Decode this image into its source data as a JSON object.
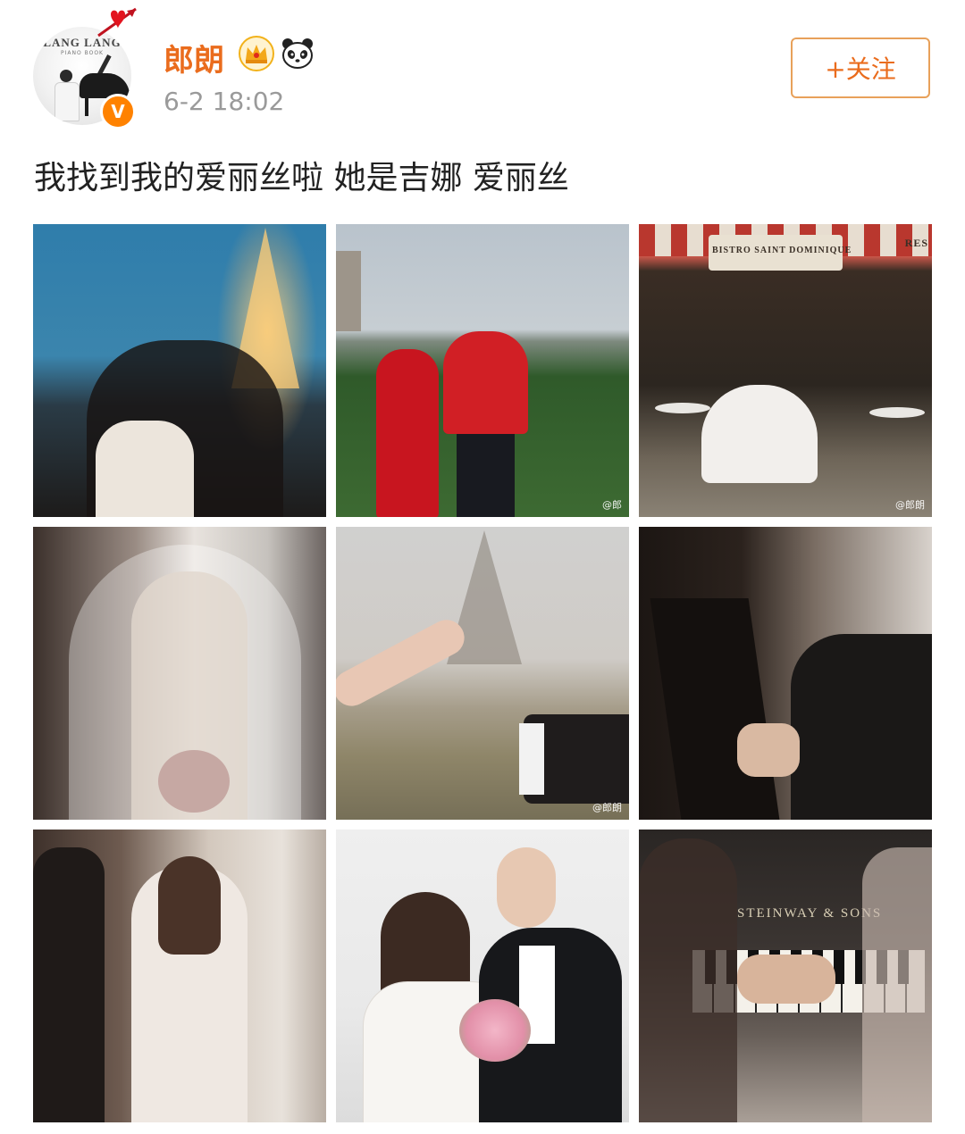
{
  "post": {
    "user": {
      "name": "郎朗",
      "avatar_logo": "LANG LANG",
      "avatar_logo_sub": "PIANO BOOK",
      "verified_mark": "V"
    },
    "time": "6-2 18:02",
    "follow_label": "+关注",
    "text": "我找到我的爱丽丝啦 她是吉娜 爱丽丝"
  },
  "photos": [
    {
      "id": "photo-1",
      "subject": "couple-eiffel-tower-night"
    },
    {
      "id": "photo-2",
      "subject": "couple-red-qipao"
    },
    {
      "id": "photo-3",
      "subject": "bistro-cafe-scene",
      "sign": "BISTRO SAINT DOMINIQUE",
      "corner_sign": "RES",
      "watermark": "@郎朗"
    },
    {
      "id": "photo-4",
      "subject": "bride-veil-window"
    },
    {
      "id": "photo-5",
      "subject": "hands-rings-eiffel-tower",
      "watermark": "@郎朗"
    },
    {
      "id": "photo-6",
      "subject": "man-playing-piano"
    },
    {
      "id": "photo-7",
      "subject": "bride-groom-window"
    },
    {
      "id": "photo-8",
      "subject": "couple-studio-portrait"
    },
    {
      "id": "photo-9",
      "subject": "hands-on-piano-keys",
      "piano_brand": "STEINWAY & SONS"
    }
  ],
  "photo2_watermark": "@郎",
  "colors": {
    "accent": "#ea6c1d",
    "verified": "#ff8200",
    "follow_border": "#e8a15a",
    "time": "#9a9a9a"
  },
  "icons": [
    "heart-arrow-icon",
    "crown-icon",
    "panda-icon",
    "verified-badge-icon"
  ]
}
